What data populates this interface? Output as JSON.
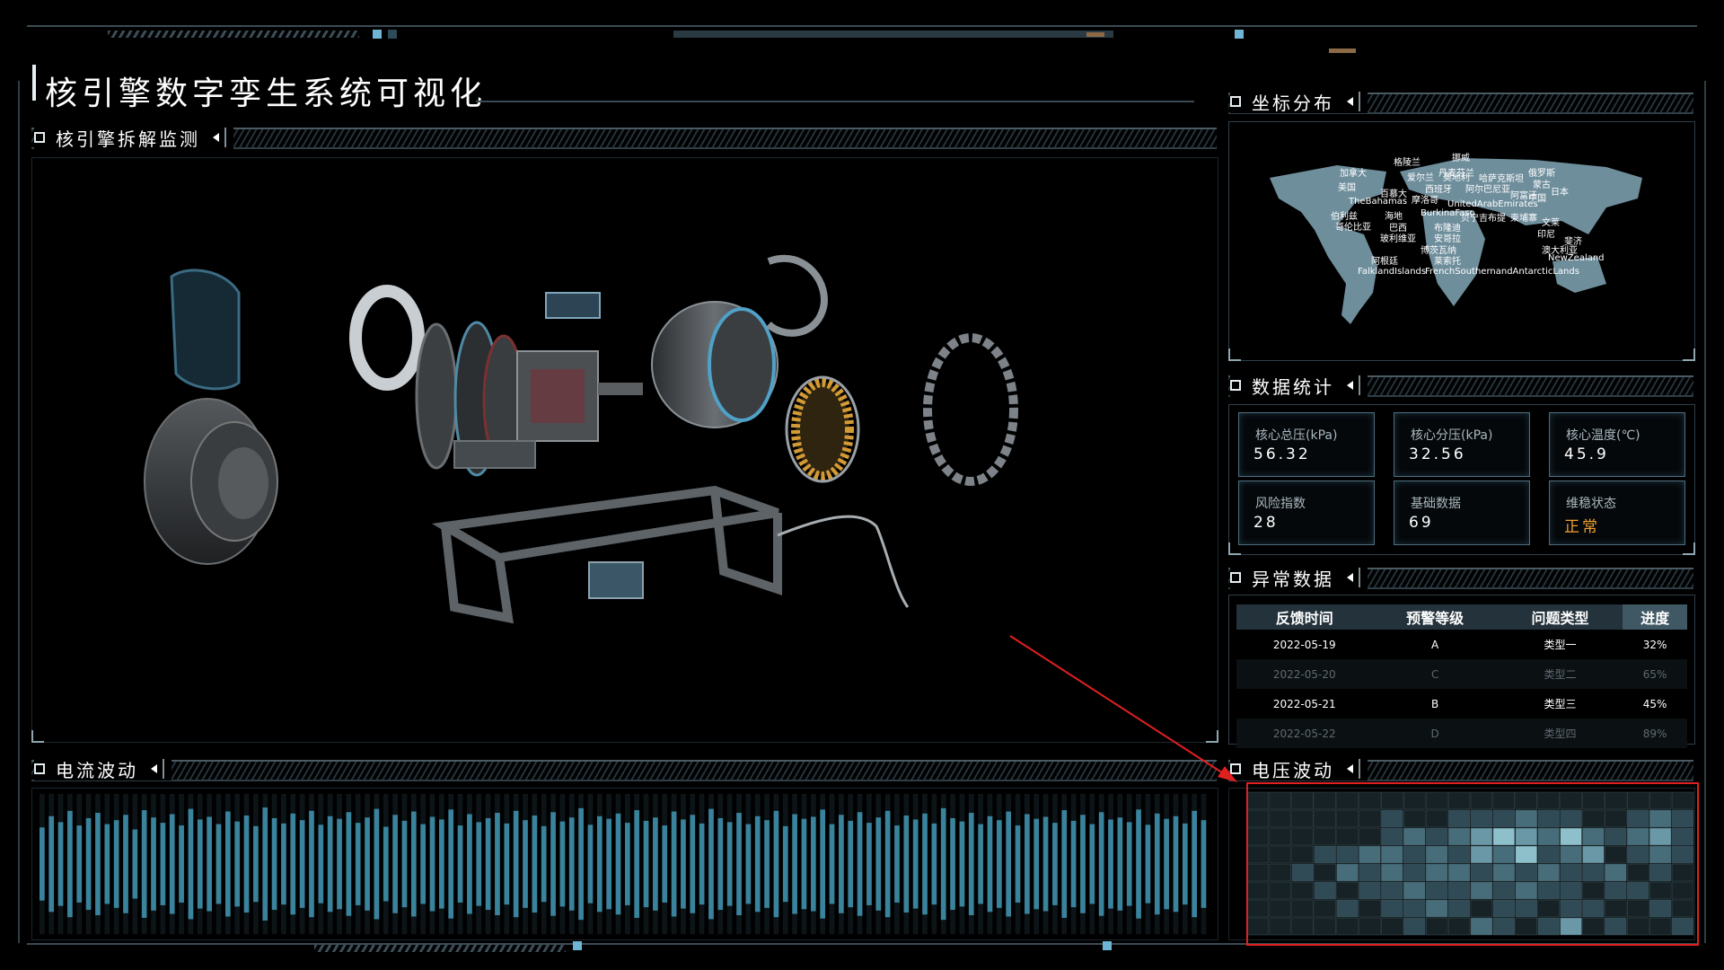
{
  "page_title": "核引擎数字孪生系统可视化",
  "sections": {
    "disassembly": "核引擎拆解监测",
    "current": "电流波动",
    "coords": "坐标分布",
    "stats": "数据统计",
    "anomaly": "异常数据",
    "voltage": "电压波动"
  },
  "map_labels": [
    "格陵兰",
    "挪威",
    "加拿大",
    "丹麦",
    "芬兰",
    "爱尔兰",
    "奥地利",
    "哈萨克斯坦",
    "俄罗斯",
    "美国",
    "蒙古",
    "百慕大",
    "西班牙",
    "阿尔巴尼亚",
    "阿富汗",
    "中国",
    "日本",
    "TheBahamas",
    "摩洛哥",
    "UnitedArabEmirates",
    "伯利兹",
    "海地",
    "BurkinaFaso",
    "贝宁",
    "吉布提",
    "柬埔寨",
    "文莱",
    "哥伦比亚",
    "巴西",
    "布隆迪",
    "印尼",
    "玻利维亚",
    "安哥拉",
    "斐济",
    "博茨瓦纳",
    "澳大利亚",
    "阿根廷",
    "莱索托",
    "NewZealand",
    "FalklandIslands",
    "FrenchSouthernandAntarcticLands"
  ],
  "stats": [
    {
      "label": "核心总压(kPa)",
      "value": "56.32"
    },
    {
      "label": "核心分压(kPa)",
      "value": "32.56"
    },
    {
      "label": "核心温度(℃)",
      "value": "45.9"
    },
    {
      "label": "风险指数",
      "value": "28"
    },
    {
      "label": "基础数据",
      "value": "69"
    },
    {
      "label": "维稳状态",
      "value": "正常"
    }
  ],
  "colors": {
    "status_ok": "#f0a030",
    "accent": "#4aa8c8",
    "panel_border": "#2f3f48",
    "annotation": "#e02020"
  },
  "anomaly_table": {
    "headers": [
      "反馈时间",
      "预警等级",
      "问题类型",
      "进度"
    ],
    "rows": [
      [
        "2022-05-19",
        "A",
        "类型一",
        "32%"
      ],
      [
        "2022-05-20",
        "C",
        "类型二",
        "65%"
      ],
      [
        "2022-05-21",
        "B",
        "类型三",
        "45%"
      ],
      [
        "2022-05-22",
        "D",
        "类型四",
        "89%"
      ]
    ]
  },
  "chart_data": [
    {
      "type": "bar",
      "title": "电流波动",
      "series": [
        {
          "values": [
            0.55,
            0.72,
            0.63,
            0.8,
            0.58,
            0.69,
            0.77,
            0.6,
            0.66,
            0.74,
            0.52,
            0.81,
            0.7,
            0.62,
            0.75,
            0.58,
            0.83,
            0.67,
            0.71,
            0.6,
            0.79,
            0.64,
            0.73,
            0.57,
            0.85,
            0.69,
            0.61,
            0.76,
            0.66,
            0.8,
            0.59,
            0.72,
            0.68,
            0.78,
            0.62,
            0.7,
            0.83,
            0.56,
            0.74,
            0.65,
            0.79,
            0.6,
            0.71,
            0.67,
            0.82,
            0.58,
            0.75,
            0.63,
            0.69,
            0.77,
            0.61,
            0.8,
            0.66,
            0.73,
            0.57,
            0.78,
            0.64,
            0.7,
            0.84,
            0.59,
            0.72,
            0.68,
            0.76,
            0.62,
            0.81,
            0.65,
            0.7,
            0.58,
            0.79,
            0.67,
            0.74,
            0.61,
            0.83,
            0.69,
            0.63,
            0.77,
            0.6,
            0.72,
            0.66,
            0.8,
            0.57,
            0.75,
            0.68,
            0.71,
            0.82,
            0.6,
            0.74,
            0.65,
            0.78,
            0.62,
            0.7,
            0.8,
            0.58,
            0.73,
            0.67,
            0.76,
            0.61,
            0.84,
            0.69,
            0.64,
            0.77,
            0.6,
            0.72,
            0.66,
            0.79,
            0.58,
            0.75,
            0.68,
            0.71,
            0.62,
            0.81,
            0.65,
            0.74,
            0.6,
            0.78,
            0.67,
            0.7,
            0.63,
            0.82,
            0.59,
            0.76,
            0.68,
            0.72,
            0.61,
            0.8,
            0.66
          ]
        }
      ]
    },
    {
      "type": "heatmap",
      "title": "电压波动",
      "rows": 8,
      "cols": 20,
      "values": [
        [
          0,
          0,
          0,
          0,
          0,
          0,
          0,
          0,
          0,
          0,
          0,
          0,
          0,
          0,
          0,
          0,
          0,
          0,
          0,
          0
        ],
        [
          0,
          0,
          0,
          0,
          0,
          0,
          1,
          0,
          0,
          1,
          1,
          1,
          2,
          1,
          1,
          0,
          0,
          1,
          2,
          1
        ],
        [
          0,
          0,
          0,
          0,
          0,
          0,
          1,
          2,
          1,
          2,
          3,
          4,
          3,
          2,
          4,
          2,
          1,
          2,
          3,
          1
        ],
        [
          0,
          0,
          0,
          1,
          1,
          2,
          2,
          1,
          2,
          1,
          3,
          2,
          4,
          1,
          2,
          3,
          0,
          1,
          2,
          1
        ],
        [
          0,
          0,
          1,
          0,
          2,
          1,
          2,
          1,
          2,
          2,
          1,
          2,
          1,
          2,
          1,
          1,
          2,
          0,
          1,
          0
        ],
        [
          0,
          0,
          0,
          1,
          0,
          1,
          1,
          2,
          1,
          1,
          2,
          1,
          2,
          1,
          1,
          0,
          1,
          1,
          0,
          0
        ],
        [
          0,
          0,
          0,
          0,
          1,
          0,
          1,
          1,
          2,
          1,
          0,
          1,
          1,
          0,
          1,
          1,
          0,
          0,
          1,
          0
        ],
        [
          0,
          0,
          0,
          0,
          0,
          0,
          0,
          1,
          0,
          0,
          2,
          1,
          0,
          1,
          3,
          0,
          1,
          0,
          0,
          1
        ]
      ]
    }
  ]
}
